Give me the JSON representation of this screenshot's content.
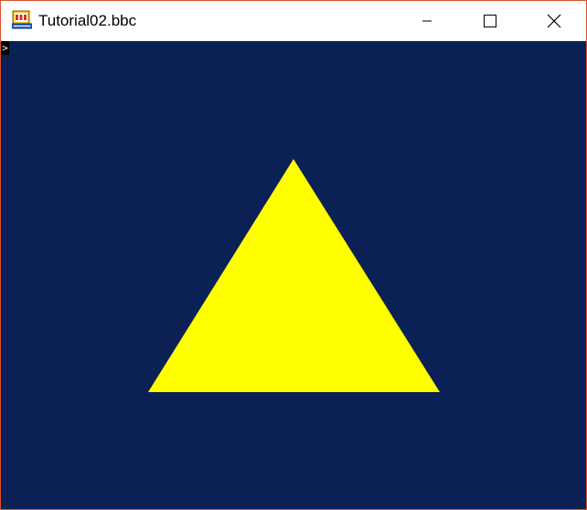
{
  "window": {
    "title": "Tutorial02.bbc",
    "app_icon": "bbc-basic-app-icon",
    "controls": [
      "minimize-icon",
      "maximize-icon",
      "close-icon"
    ]
  },
  "console": {
    "prompt": ">"
  },
  "scene": {
    "background_color": "#0b2155",
    "shape": "triangle",
    "shape_color": "#ffff00"
  },
  "colors": {
    "window_border": "#d9522c"
  }
}
